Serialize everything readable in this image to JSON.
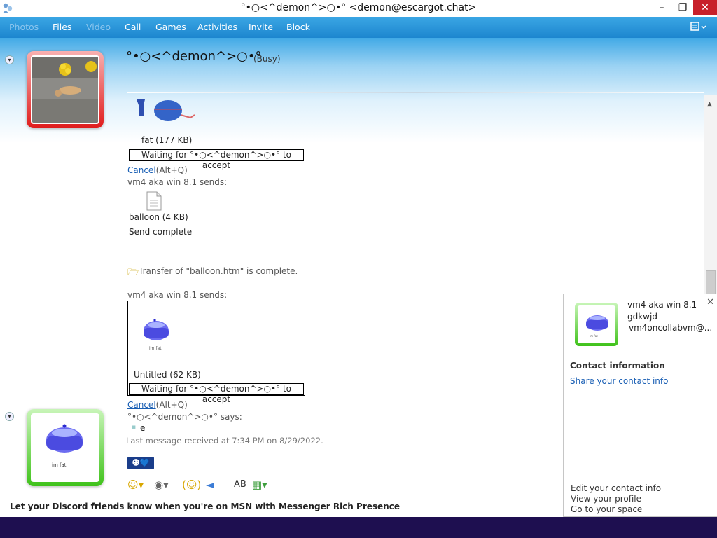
{
  "window": {
    "title": "°•○<^demon^>○•° <demon@escargot.chat>",
    "minimize": "–",
    "maximize": "❐",
    "close": "✕"
  },
  "menu": {
    "items": [
      "Photos",
      "Files",
      "Video",
      "Call",
      "Games",
      "Activities",
      "Invite",
      "Block"
    ],
    "disabled": [
      "Photos",
      "Video"
    ],
    "options_icon": "options-icon"
  },
  "contact": {
    "name": "°•○<^demon^>○•°",
    "status": "(Busy)"
  },
  "conversation": {
    "transfer1": {
      "file_label": "fat (177 KB)",
      "waiting": "Waiting for °•○<^demon^>○•° to accept",
      "cancel_link": "Cancel",
      "cancel_shortcut": "(Alt+Q)"
    },
    "sender1": "vm4 aka win 8.1 sends:",
    "transfer2": {
      "file_label": "balloon (4 KB)",
      "status": "Send complete"
    },
    "complete_msg": "Transfer of \"balloon.htm\" is complete.",
    "sender2": "vm4 aka win 8.1 sends:",
    "transfer3": {
      "image_caption": "im fat",
      "file_label": "Untitled (62 KB)",
      "waiting": "Waiting for °•○<^demon^>○•° to accept",
      "cancel_link": "Cancel",
      "cancel_shortcut": "(Alt+Q)"
    },
    "says_line": "°•○<^demon^>○•° says:",
    "message": "e",
    "last_received": "Last message received at 7:34 PM on 8/29/2022."
  },
  "own_avatar_caption": "im fat",
  "rich_presence": "Let your Discord friends know when you're on MSN with Messenger Rich Presence",
  "contact_panel": {
    "display_name": "vm4 aka win 8.1",
    "personal_message": "gdkwjd",
    "email": "vm4oncollabvm@...",
    "avatar_caption": "im fat",
    "section_title": "Contact information",
    "share_link": "Share your contact info",
    "links": [
      "Edit your contact info",
      "View your profile",
      "Go to your space"
    ]
  }
}
